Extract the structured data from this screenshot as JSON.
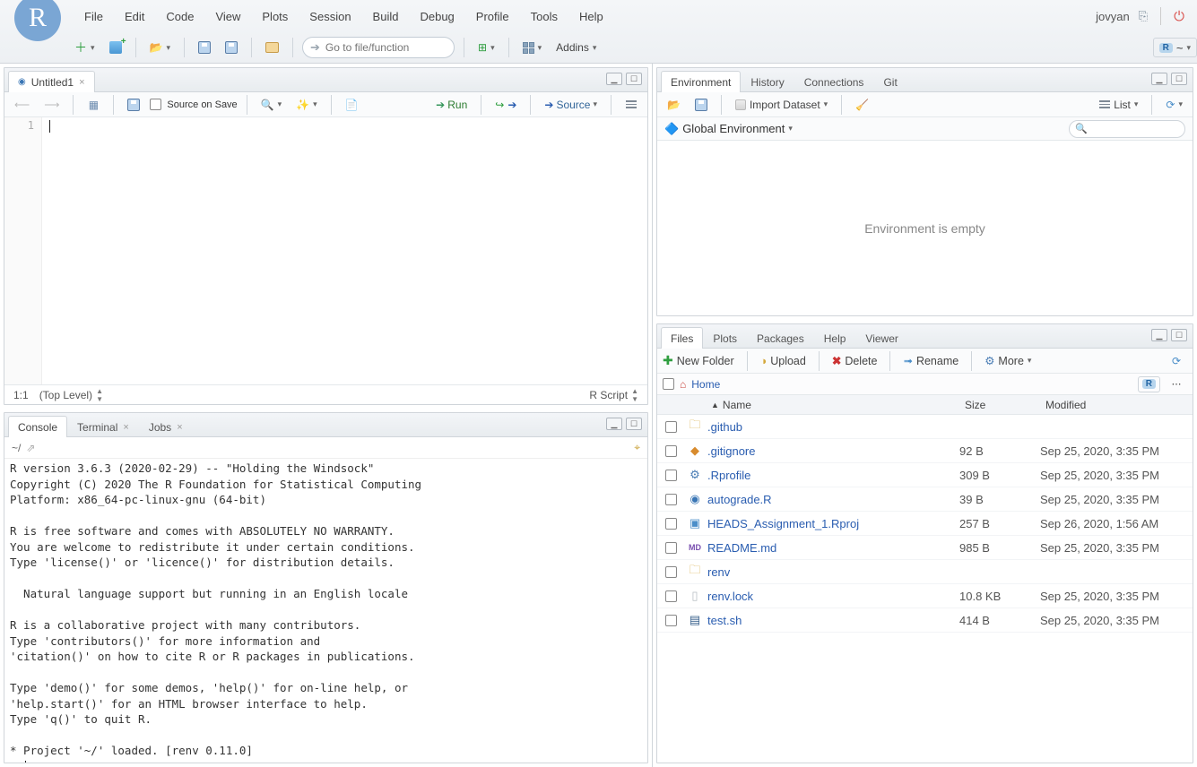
{
  "menu": {
    "items": [
      "File",
      "Edit",
      "Code",
      "View",
      "Plots",
      "Session",
      "Build",
      "Debug",
      "Profile",
      "Tools",
      "Help"
    ]
  },
  "user": {
    "name": "jovyan"
  },
  "toolbar": {
    "goto_placeholder": "Go to file/function",
    "addins": "Addins"
  },
  "project_switch": "~",
  "source": {
    "tab": "Untitled1",
    "source_on_save": "Source on Save",
    "run": "Run",
    "source_btn": "Source",
    "line_no": "1",
    "status_pos": "1:1",
    "status_scope": "(Top Level)",
    "status_lang": "R Script"
  },
  "console": {
    "tabs": [
      "Console",
      "Terminal",
      "Jobs"
    ],
    "path": "~/",
    "text": "R version 3.6.3 (2020-02-29) -- \"Holding the Windsock\"\nCopyright (C) 2020 The R Foundation for Statistical Computing\nPlatform: x86_64-pc-linux-gnu (64-bit)\n\nR is free software and comes with ABSOLUTELY NO WARRANTY.\nYou are welcome to redistribute it under certain conditions.\nType 'license()' or 'licence()' for distribution details.\n\n  Natural language support but running in an English locale\n\nR is a collaborative project with many contributors.\nType 'contributors()' for more information and\n'citation()' on how to cite R or R packages in publications.\n\nType 'demo()' for some demos, 'help()' for on-line help, or\n'help.start()' for an HTML browser interface to help.\nType 'q()' to quit R.\n\n* Project '~/' loaded. [renv 0.11.0]",
    "prompt": ">"
  },
  "env": {
    "tabs": [
      "Environment",
      "History",
      "Connections",
      "Git"
    ],
    "import": "Import Dataset",
    "list": "List",
    "scope": "Global Environment",
    "empty": "Environment is empty"
  },
  "files": {
    "tabs": [
      "Files",
      "Plots",
      "Packages",
      "Help",
      "Viewer"
    ],
    "new_folder": "New Folder",
    "upload": "Upload",
    "delete": "Delete",
    "rename": "Rename",
    "more": "More",
    "home": "Home",
    "cols": {
      "name": "Name",
      "size": "Size",
      "modified": "Modified"
    },
    "rows": [
      {
        "icon": "folder",
        "name": ".github",
        "size": "",
        "mod": ""
      },
      {
        "icon": "git",
        "name": ".gitignore",
        "size": "92 B",
        "mod": "Sep 25, 2020, 3:35 PM"
      },
      {
        "icon": "gear",
        "name": ".Rprofile",
        "size": "309 B",
        "mod": "Sep 25, 2020, 3:35 PM"
      },
      {
        "icon": "rdoc",
        "name": "autograde.R",
        "size": "39 B",
        "mod": "Sep 25, 2020, 3:35 PM"
      },
      {
        "icon": "rproj",
        "name": "HEADS_Assignment_1.Rproj",
        "size": "257 B",
        "mod": "Sep 26, 2020, 1:56 AM"
      },
      {
        "icon": "md",
        "name": "README.md",
        "size": "985 B",
        "mod": "Sep 25, 2020, 3:35 PM"
      },
      {
        "icon": "folder",
        "name": "renv",
        "size": "",
        "mod": ""
      },
      {
        "icon": "file",
        "name": "renv.lock",
        "size": "10.8 KB",
        "mod": "Sep 25, 2020, 3:35 PM"
      },
      {
        "icon": "sh",
        "name": "test.sh",
        "size": "414 B",
        "mod": "Sep 25, 2020, 3:35 PM"
      }
    ]
  }
}
